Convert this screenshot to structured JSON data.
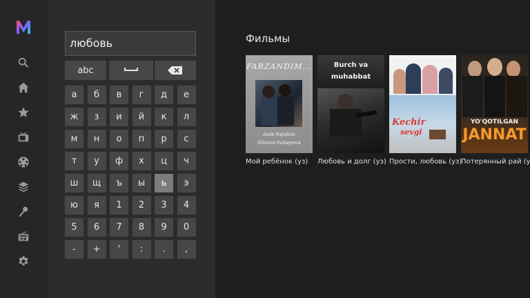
{
  "nav": {
    "logo": "m-logo",
    "items": [
      {
        "icon": "search-icon",
        "name": "search"
      },
      {
        "icon": "home-icon",
        "name": "home"
      },
      {
        "icon": "star-icon",
        "name": "favorites"
      },
      {
        "icon": "tv-icon",
        "name": "tv"
      },
      {
        "icon": "film-reel-icon",
        "name": "movies"
      },
      {
        "icon": "layers-icon",
        "name": "collections"
      },
      {
        "icon": "microphone-icon",
        "name": "music"
      },
      {
        "icon": "radio-icon",
        "name": "radio"
      },
      {
        "icon": "gear-icon",
        "name": "settings"
      }
    ]
  },
  "search": {
    "query": "любовь"
  },
  "keyboard": {
    "mode_label": "abc",
    "space_icon": "space-bar-icon",
    "backspace_icon": "backspace-icon",
    "rows": [
      [
        "а",
        "б",
        "в",
        "г",
        "д",
        "е"
      ],
      [
        "ж",
        "з",
        "и",
        "й",
        "к",
        "л"
      ],
      [
        "м",
        "н",
        "о",
        "п",
        "р",
        "с"
      ],
      [
        "т",
        "у",
        "ф",
        "х",
        "ц",
        "ч"
      ],
      [
        "ш",
        "щ",
        "ъ",
        "ы",
        "ь",
        "э"
      ],
      [
        "ю",
        "я",
        "1",
        "2",
        "3",
        "4"
      ],
      [
        "5",
        "6",
        "7",
        "8",
        "9",
        "0"
      ],
      [
        "-",
        "+",
        "'",
        ":",
        ".",
        ","
      ]
    ],
    "focused": "ь"
  },
  "results": {
    "title": "Фильмы",
    "items": [
      {
        "title": "Мой ребёнок (уз)",
        "poster_text": [
          "FARZANDIM...",
          "Asila Rajabov",
          "Dilnoza Kubayeva"
        ]
      },
      {
        "title": "Любовь и долг (уз)",
        "poster_text": [
          "Burch va",
          "muhabbat"
        ]
      },
      {
        "title": "Прости, любовь (уз)",
        "poster_text": [
          "Kechir",
          "sevgi"
        ]
      },
      {
        "title": "Потерянный рай (уз)",
        "poster_text": [
          "YO'QOTILGAN",
          "JANNAT"
        ]
      }
    ]
  },
  "colors": {
    "rail_bg": "#262626",
    "keyboard_bg": "#2c2c2c",
    "key_bg": "#474747",
    "key_focus_bg": "#7c7c7c",
    "content_bg": "#1e1e1e"
  }
}
